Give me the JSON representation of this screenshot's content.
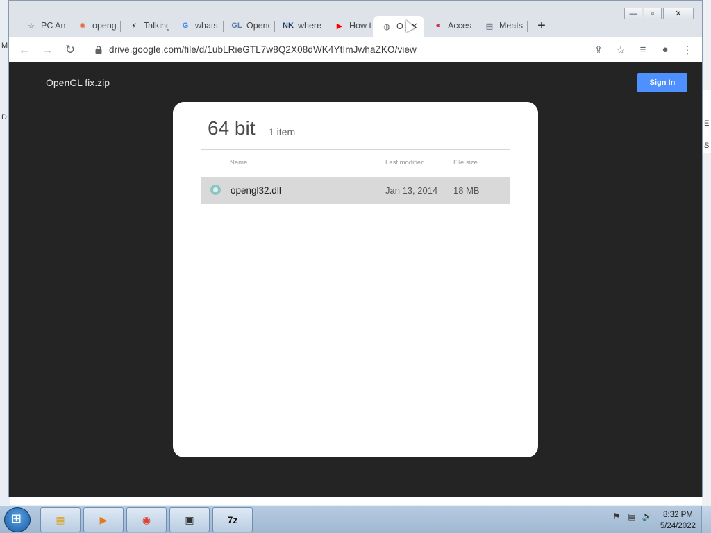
{
  "desktop": {
    "left_letter_top": "M",
    "left_letter_mid": "D",
    "right_letter_a": "E",
    "right_letter_b": "S"
  },
  "window_controls": {
    "minimize": "—",
    "maximize": "▫",
    "close": "✕"
  },
  "tabs": [
    {
      "label": "PC An",
      "icon": "star-icon",
      "glyph": "☆",
      "color": "#5f6368"
    },
    {
      "label": "openg",
      "icon": "gear-flower-icon",
      "glyph": "✺",
      "color": "#e8663d"
    },
    {
      "label": "Talking",
      "icon": "lightning-icon",
      "glyph": "⚡",
      "color": "#111111"
    },
    {
      "label": "whats",
      "icon": "google-icon",
      "glyph": "G",
      "color": "#4285f4"
    },
    {
      "label": "Openc",
      "icon": "gl-icon",
      "glyph": "GL",
      "color": "#5a7fa6"
    },
    {
      "label": "where",
      "icon": "nk-icon",
      "glyph": "NK",
      "color": "#1d3a5f"
    },
    {
      "label": "How t",
      "icon": "youtube-icon",
      "glyph": "▶",
      "color": "#ff0000"
    },
    {
      "label": "O",
      "icon": "globe-icon",
      "glyph": "◍",
      "color": "#5f6368",
      "active": true,
      "close": "✕"
    },
    {
      "label": "Acces",
      "icon": "link-icon",
      "glyph": "⚭",
      "color": "#c8102e"
    },
    {
      "label": "Meats",
      "icon": "meats-icon",
      "glyph": "▤",
      "color": "#2b2b4a"
    }
  ],
  "newtab": "+",
  "toolbar": {
    "back": "←",
    "forward": "→",
    "reload": "↻",
    "url": "drive.google.com/file/d/1ubLRieGTL7w8Q2X08dWK4YtImJwhaZKO/view",
    "share": "⇪",
    "bookmark": "☆",
    "media": "≡",
    "profile": "●",
    "menu": "⋮"
  },
  "viewer": {
    "title": "OpenGL fix.zip",
    "signin": "Sign In",
    "folder": {
      "name": "64 bit",
      "count": "1 item"
    },
    "columns": {
      "name": "Name",
      "modified": "Last modified",
      "size": "File size"
    },
    "files": [
      {
        "name": "opengl32.dll",
        "modified": "Jan 13, 2014",
        "size": "18 MB"
      }
    ]
  },
  "taskbar": {
    "apps": [
      {
        "name": "explorer",
        "glyph": "▦",
        "color": "#d9a62e"
      },
      {
        "name": "media",
        "glyph": "▶",
        "color": "#e07b1a"
      },
      {
        "name": "chrome",
        "glyph": "◉",
        "color": "#db4437"
      },
      {
        "name": "network",
        "glyph": "▣",
        "color": "#333333"
      },
      {
        "name": "7zip",
        "glyph": "7z",
        "color": "#111111"
      }
    ],
    "tray": [
      "⚑",
      "▤",
      "🔊"
    ],
    "time": "8:32 PM",
    "date": "5/24/2022"
  }
}
